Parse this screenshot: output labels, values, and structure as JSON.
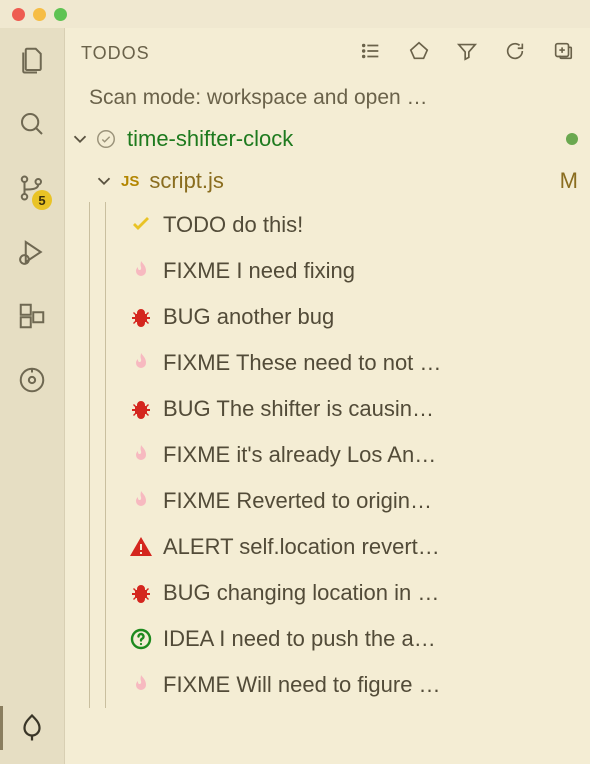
{
  "panel": {
    "title": "TODOS",
    "scan_mode": "Scan mode: workspace and open …"
  },
  "activity": {
    "scm_badge": "5"
  },
  "workspace": {
    "name": "time-shifter-clock"
  },
  "file": {
    "icon_label": "JS",
    "name": "script.js",
    "modified": "M"
  },
  "todos": [
    {
      "type": "todo",
      "text": "TODO do this!"
    },
    {
      "type": "fixme",
      "text": "FIXME I need fixing"
    },
    {
      "type": "bug",
      "text": "BUG another bug"
    },
    {
      "type": "fixme",
      "text": "FIXME These need to not …"
    },
    {
      "type": "bug",
      "text": "BUG The shifter is causin…"
    },
    {
      "type": "fixme",
      "text": "FIXME it's already Los An…"
    },
    {
      "type": "fixme",
      "text": "FIXME Reverted to origin…"
    },
    {
      "type": "alert",
      "text": "ALERT self.location revert…"
    },
    {
      "type": "bug",
      "text": "BUG changing location in …"
    },
    {
      "type": "idea",
      "text": "IDEA I need to push the a…"
    },
    {
      "type": "fixme",
      "text": "FIXME Will need to figure …"
    }
  ]
}
